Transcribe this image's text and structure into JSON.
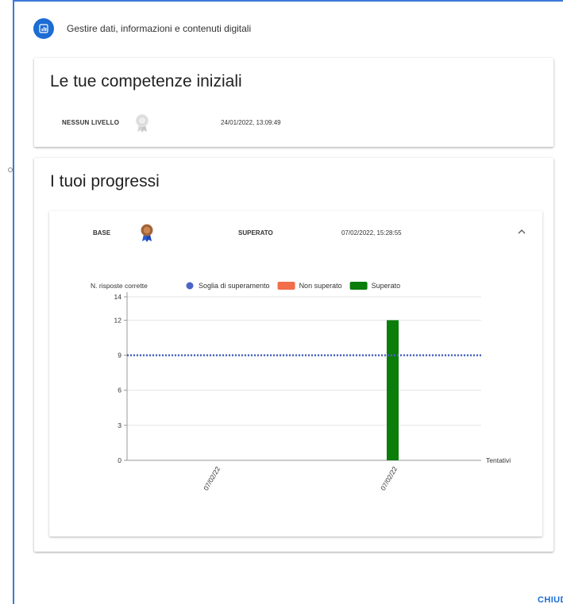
{
  "header": {
    "title": "Gestire dati, informazioni e contenuti digitali",
    "icon": "bar-chart-icon",
    "accent": "#1c6cd4"
  },
  "initial": {
    "title": "Le tue competenze iniziali",
    "level": "NESSUN LIVELLO",
    "medal_icon": "medal-grey-icon",
    "date": "24/01/2022, 13:09:49"
  },
  "progress": {
    "title": "I tuoi progressi",
    "row": {
      "level": "BASE",
      "medal_icon": "medal-bronze-icon",
      "status": "SUPERATO",
      "date": "07/02/2022, 15:28:55",
      "expand_icon": "chevron-up-icon"
    }
  },
  "chart_data": {
    "type": "bar",
    "ylabel": "N. risposte corrette",
    "xlabel": "Tentativi",
    "ylim": [
      0,
      14
    ],
    "yticks": [
      0,
      3,
      6,
      9,
      12,
      14
    ],
    "categories": [
      "07/02/22",
      "07/02/22"
    ],
    "values": [
      0,
      12
    ],
    "bar_status": [
      "Superato",
      "Superato"
    ],
    "threshold": 9,
    "grid": true,
    "legend_position": "top",
    "legend": [
      {
        "name": "Soglia di superamento",
        "color": "#4a64c8",
        "shape": "circle"
      },
      {
        "name": "Non superato",
        "color": "#f26d4a",
        "shape": "rect"
      },
      {
        "name": "Superato",
        "color": "#0a7d0a",
        "shape": "rect"
      }
    ]
  },
  "footer": {
    "close_label": "CHIUDI"
  }
}
